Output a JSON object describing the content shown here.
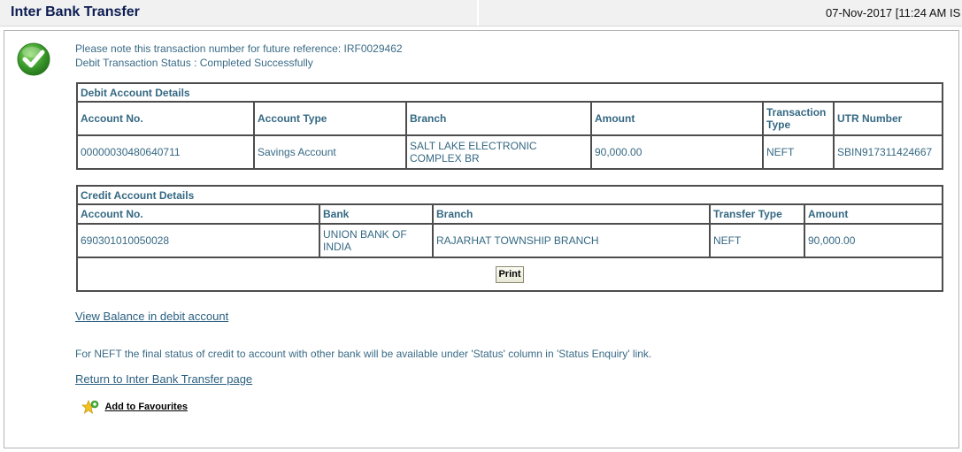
{
  "header": {
    "title": "Inter Bank Transfer",
    "datetime": "07-Nov-2017 [11:24 AM IS"
  },
  "messages": {
    "line1": "Please note this transaction number for future reference: IRF0029462",
    "line2": "Debit Transaction Status : Completed Successfully"
  },
  "debit": {
    "caption": "Debit Account Details",
    "headers": [
      "Account No.",
      "Account Type",
      "Branch",
      "Amount",
      "Transaction Type",
      "UTR Number"
    ],
    "row": [
      "00000030480640711",
      "Savings Account",
      "SALT LAKE ELECTRONIC COMPLEX BR",
      "90,000.00",
      "NEFT",
      "SBIN917311424667"
    ]
  },
  "credit": {
    "caption": "Credit Account Details",
    "headers": [
      "Account No.",
      "Bank",
      "Branch",
      "Transfer Type",
      "Amount"
    ],
    "row": [
      "690301010050028",
      "UNION BANK OF INDIA",
      "RAJARHAT TOWNSHIP BRANCH",
      "NEFT",
      "90,000.00"
    ],
    "print_label": "Print"
  },
  "links": {
    "view_balance": "View Balance in debit account",
    "return": "Return to Inter Bank Transfer page",
    "add_favourites": "Add to Favourites"
  },
  "note": "For NEFT the final status of credit to account with other bank will be available under 'Status' column in 'Status Enquiry' link.",
  "icons": {
    "status": "check-icon",
    "favourites": "star-add-icon"
  },
  "colors": {
    "header_title": "#0d1d52",
    "text": "#356983",
    "success_green": "#3a9a2b"
  }
}
